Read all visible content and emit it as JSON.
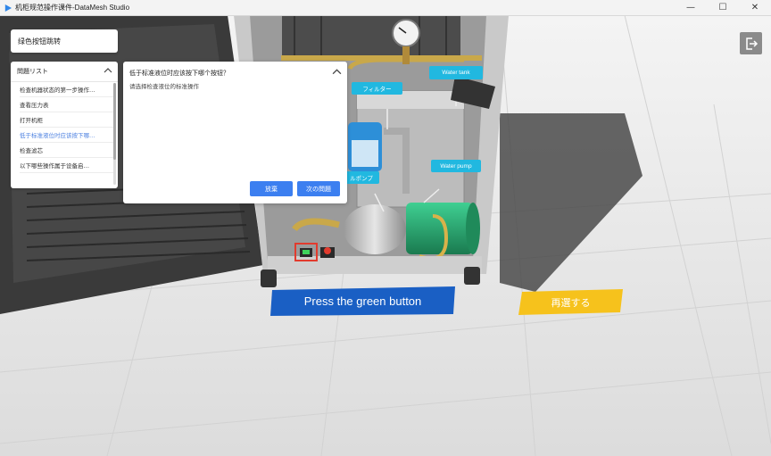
{
  "window": {
    "title": "机柜规范操作课件-DataMesh Studio",
    "minimize": "—",
    "maximize": "☐",
    "close": "✕"
  },
  "left_panel": {
    "jump_button": "绿色按钮跳转",
    "list_title": "問題リスト",
    "items": [
      {
        "label": "检查机器状态的第一步操作…"
      },
      {
        "label": "查看压力表"
      },
      {
        "label": "打开机柜"
      },
      {
        "label": "低于标准液位时应该按下哪…"
      },
      {
        "label": "检查滤芯"
      },
      {
        "label": "以下哪些操作属于设备启…"
      }
    ]
  },
  "dialog": {
    "title": "低于标准液位时应该按下哪个按钮？",
    "hint": "请选择检查液位的标准操作",
    "give_up": "放棄",
    "next": "次の問題"
  },
  "scene_labels": {
    "filter": "フィルター",
    "water_tank": "Water tank",
    "pump": "ルポンプ",
    "water_pump": "Water pump"
  },
  "actions": {
    "press": "Press the green button",
    "retry": "再選する"
  },
  "colors": {
    "accent": "#3c7ff0",
    "active_item": "#4a7fe0",
    "tag": "#21b8e0",
    "press_button": "#1a5fc4",
    "retry_button": "#f6c21c"
  },
  "icons": {
    "app": "play-triangle-icon",
    "exit": "exit-door-icon",
    "collapse": "chevron-up-icon"
  }
}
